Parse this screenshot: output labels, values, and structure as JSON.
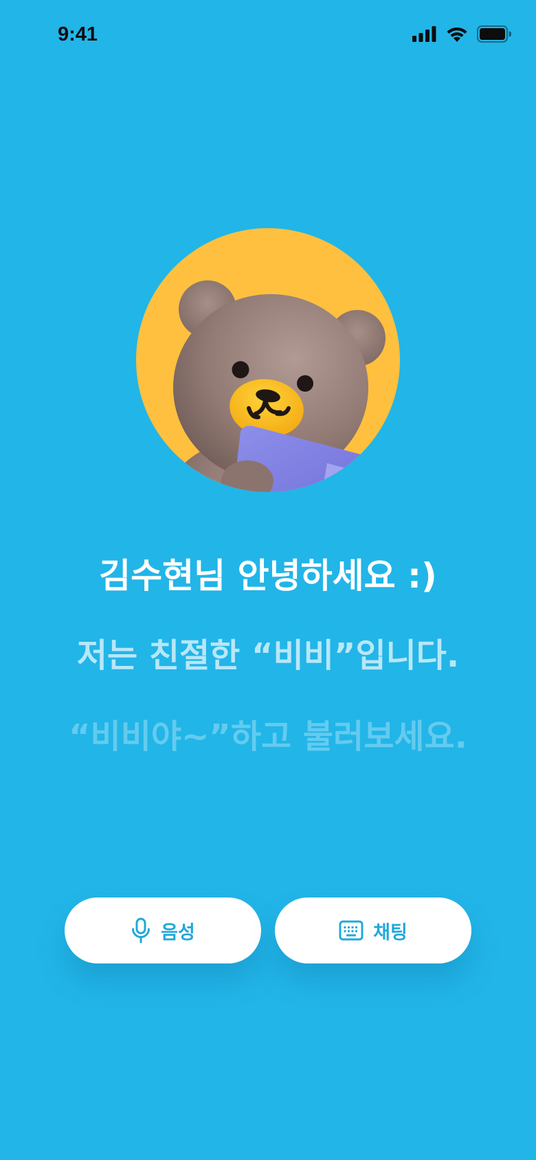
{
  "status_bar": {
    "time": "9:41",
    "icons": [
      "cellular-signal-icon",
      "wifi-icon",
      "battery-icon"
    ]
  },
  "avatar": {
    "icon": "bear-character-icon"
  },
  "greeting": {
    "line1": "김수현님 안녕하세요 :)",
    "line2": "저는 친절한 “비비”입니다.",
    "line3": "“비비야~”하고 불러보세요."
  },
  "actions": {
    "voice_label": "음성",
    "voice_icon": "microphone-icon",
    "chat_label": "채팅",
    "chat_icon": "keyboard-icon"
  },
  "colors": {
    "background": "#22B5E8",
    "avatar_circle": "#FFC03F",
    "button_text": "#22A8DB"
  }
}
